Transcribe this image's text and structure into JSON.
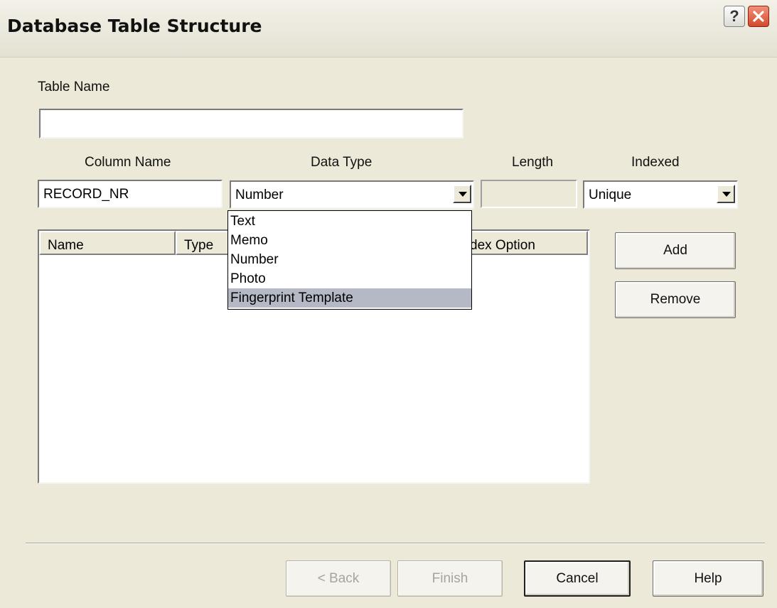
{
  "window": {
    "title": "Database Table Structure",
    "help_button": "?"
  },
  "form": {
    "table_name_label": "Table Name",
    "table_name_value": "",
    "column_name_label": "Column Name",
    "column_name_value": "RECORD_NR",
    "data_type_label": "Data Type",
    "data_type_value": "Number",
    "length_label": "Length",
    "length_value": "",
    "indexed_label": "Indexed",
    "indexed_value": "Unique"
  },
  "data_type_options": [
    {
      "label": "Text",
      "selected": false
    },
    {
      "label": "Memo",
      "selected": false
    },
    {
      "label": "Number",
      "selected": false
    },
    {
      "label": "Photo",
      "selected": false
    },
    {
      "label": "Fingerprint Template",
      "selected": true
    }
  ],
  "columns_list": {
    "headers": [
      "Name",
      "Type",
      "dex Option"
    ],
    "rows": []
  },
  "side_buttons": {
    "add": "Add",
    "remove": "Remove"
  },
  "footer_buttons": {
    "back": "< Back",
    "finish": "Finish",
    "cancel": "Cancel",
    "help": "Help"
  },
  "colors": {
    "dialog_background": "#ece9d8",
    "selected_item": "#b5b9c5",
    "close_button": "#d34a2c"
  }
}
